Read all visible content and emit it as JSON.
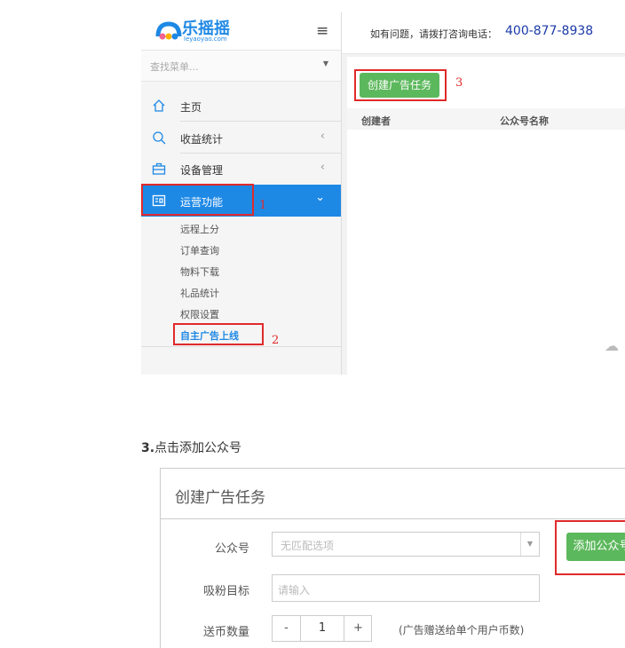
{
  "app": {
    "logo_text": "乐摇摇",
    "logo_sub": "leyaoyao.com",
    "contact_text": "如有问题，请拨打咨询电话：",
    "phone": "400-877-8938"
  },
  "sidebar": {
    "search_placeholder": "查找菜单...",
    "items": [
      {
        "label": "主页",
        "icon": "home-icon"
      },
      {
        "label": "收益统计",
        "icon": "search-icon"
      },
      {
        "label": "设备管理",
        "icon": "briefcase-icon"
      },
      {
        "label": "运营功能",
        "icon": "app-icon",
        "active": true
      }
    ],
    "sub_items": [
      "远程上分",
      "订单查询",
      "物料下载",
      "礼品统计",
      "权限设置",
      "自主广告上线"
    ]
  },
  "main": {
    "create_button": "创建广告任务",
    "columns": [
      "创建者",
      "公众号名称"
    ]
  },
  "annotations": {
    "n1": "1",
    "n2": "2",
    "n3": "3"
  },
  "step": {
    "number": "3.",
    "text": "点击添加公众号"
  },
  "dialog": {
    "title": "创建广告任务",
    "fields": [
      {
        "label": "公众号",
        "placeholder": "无匹配选项"
      },
      {
        "label": "吸粉目标",
        "placeholder": "请输入"
      },
      {
        "label": "送币数量",
        "value": "1",
        "note": "(广告赠送给单个用户币数)"
      }
    ],
    "add_button": "添加公众号",
    "minus": "-",
    "plus": "+"
  },
  "colors": {
    "accent_blue": "#1e88e5",
    "green": "#5cb85c",
    "red": "#e02a2a"
  }
}
